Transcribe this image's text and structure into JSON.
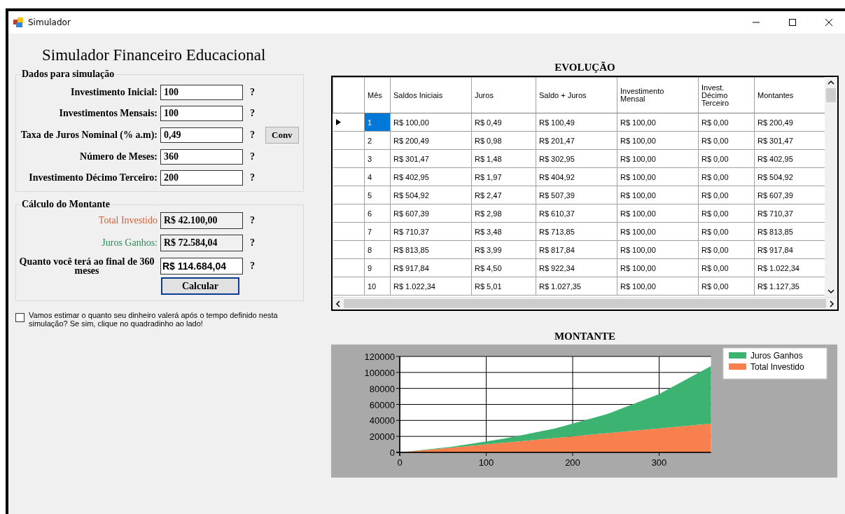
{
  "window": {
    "title": "Simulador"
  },
  "heading": "Simulador Financeiro Educacional",
  "inputs_group": {
    "title": "Dados para simulação",
    "fields": [
      {
        "label": "Investimento Inicial:",
        "value": "100",
        "help": "?"
      },
      {
        "label": "Investimentos Mensais:",
        "value": "100",
        "help": "?"
      },
      {
        "label": "Taxa de Juros Nominal (% a.m):",
        "value": "0,49",
        "help": "?",
        "button": "Conv"
      },
      {
        "label": "Número de Meses:",
        "value": "360",
        "help": "?"
      },
      {
        "label": "Investimento Décimo Terceiro:",
        "value": "200",
        "help": "?"
      }
    ]
  },
  "results_group": {
    "title": "Cálculo do Montante",
    "fields": [
      {
        "label": "Total Investido",
        "value": "R$ 42.100,00",
        "help": "?",
        "color": "#d2603a"
      },
      {
        "label": "Juros Ganhos:",
        "value": "R$ 72.584,04",
        "help": "?",
        "color": "#2e8b57"
      },
      {
        "label": "Quanto você terá ao final de 360 meses",
        "value": "R$ 114.684,04",
        "help": "?",
        "color": "#000000"
      }
    ],
    "button": "Calcular"
  },
  "estimate": {
    "text": "Vamos estimar o quanto seu dinheiro valerá após o tempo definido nesta simulação? Se sim, clique no quadradinho ao lado!",
    "checked": false
  },
  "table": {
    "title": "EVOLUÇÃO",
    "columns": [
      "Mês",
      "Saldos Iniciais",
      "Juros",
      "Saldo + Juros",
      "Investimento Mensal",
      "Invest. Décimo Terceiro",
      "Montantes"
    ],
    "rows": [
      {
        "cells": [
          "1",
          "R$ 100,00",
          "R$ 0,49",
          "R$ 100,49",
          "R$ 100,00",
          "R$ 0,00",
          "R$ 200,49"
        ],
        "selected": true
      },
      {
        "cells": [
          "2",
          "R$ 200,49",
          "R$ 0,98",
          "R$ 201,47",
          "R$ 100,00",
          "R$ 0,00",
          "R$ 301,47"
        ],
        "selected": false
      },
      {
        "cells": [
          "3",
          "R$ 301,47",
          "R$ 1,48",
          "R$ 302,95",
          "R$ 100,00",
          "R$ 0,00",
          "R$ 402,95"
        ],
        "selected": false
      },
      {
        "cells": [
          "4",
          "R$ 402,95",
          "R$ 1,97",
          "R$ 404,92",
          "R$ 100,00",
          "R$ 0,00",
          "R$ 504,92"
        ],
        "selected": false
      },
      {
        "cells": [
          "5",
          "R$ 504,92",
          "R$ 2,47",
          "R$ 507,39",
          "R$ 100,00",
          "R$ 0,00",
          "R$ 607,39"
        ],
        "selected": false
      },
      {
        "cells": [
          "6",
          "R$ 607,39",
          "R$ 2,98",
          "R$ 610,37",
          "R$ 100,00",
          "R$ 0,00",
          "R$ 710,37"
        ],
        "selected": false
      },
      {
        "cells": [
          "7",
          "R$ 710,37",
          "R$ 3,48",
          "R$ 713,85",
          "R$ 100,00",
          "R$ 0,00",
          "R$ 813,85"
        ],
        "selected": false
      },
      {
        "cells": [
          "8",
          "R$ 813,85",
          "R$ 3,99",
          "R$ 817,84",
          "R$ 100,00",
          "R$ 0,00",
          "R$ 917,84"
        ],
        "selected": false
      },
      {
        "cells": [
          "9",
          "R$ 917,84",
          "R$ 4,50",
          "R$ 922,34",
          "R$ 100,00",
          "R$ 0,00",
          "R$ 1.022,34"
        ],
        "selected": false
      },
      {
        "cells": [
          "10",
          "R$ 1.022,34",
          "R$ 5,01",
          "R$ 1.027,35",
          "R$ 100,00",
          "R$ 0,00",
          "R$ 1.127,35"
        ],
        "selected": false
      }
    ]
  },
  "chart": {
    "title": "MONTANTE",
    "chart_data": {
      "type": "area",
      "stacked": true,
      "x": [
        0,
        60,
        120,
        180,
        240,
        300,
        360
      ],
      "series": [
        {
          "name": "Juros Ganhos",
          "color": "#3cb371",
          "values": [
            0,
            1000,
            5000,
            12000,
            24000,
            43000,
            72000
          ]
        },
        {
          "name": "Total Investido",
          "color": "#f7804e",
          "values": [
            0,
            6000,
            12000,
            18000,
            24000,
            30000,
            36000
          ]
        }
      ],
      "grid": true,
      "legend": true,
      "xlim": [
        0,
        360
      ],
      "ylim": [
        0,
        120000
      ],
      "xticks": [
        0,
        100,
        200,
        300
      ],
      "yticks": [
        0,
        20000,
        40000,
        60000,
        80000,
        100000,
        120000
      ]
    }
  }
}
